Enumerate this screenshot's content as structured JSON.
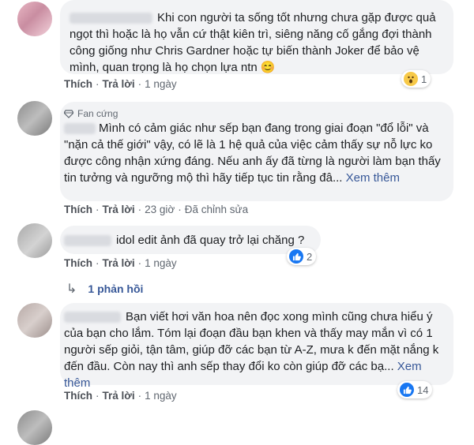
{
  "comments": [
    {
      "text": "Khi con người ta sống tốt nhưng chưa gặp được quả ngọt thì hoặc là họ vẫn cứ thật kiên trì, siêng năng cố gắng đợi thành công giống như Chris Gardner hoặc tự biến thành Joker để bảo vệ mình, quan trọng là họ chọn lựa ntn 😊",
      "like": "Thích",
      "reply": "Trả lời",
      "time": "1 ngày",
      "reaction_count": "1"
    },
    {
      "badge": "Fan cứng",
      "text": "Mình có cảm giác như sếp bạn đang trong giai đoạn \"đổ lỗi\" và \"nặn cả thế giới\" vậy, có lẽ là 1 hệ quả của việc cảm thấy sự nỗ lực ko được công nhận xứng đáng. Nếu anh ấy đã từng là người làm bạn thấy tin tưởng và ngưỡng mộ thì hãy tiếp tục tin rằng đâ...",
      "see_more": "Xem thêm",
      "like": "Thích",
      "reply": "Trả lời",
      "time": "23 giờ",
      "edited": "Đã chỉnh sửa"
    },
    {
      "text": "idol edit ảnh đã quay trở lại chăng ?",
      "like": "Thích",
      "reply": "Trả lời",
      "time": "1 ngày",
      "reaction_count": "2",
      "replies_label": "1 phản hồi"
    },
    {
      "text": "Bạn viết hơi văn hoa nên đọc xong mình cũng chưa hiểu ý của bạn cho lắm. Tóm lại đoạn đầu bạn khen và thấy may mắn vì có 1 người sếp giỏi, tận tâm, giúp đỡ các bạn từ A-Z, mưa k đến mặt nắng k đến đầu. Còn nay thì anh sếp thay đổi ko còn giúp đỡ các bạ...",
      "see_more": "Xem thêm",
      "like": "Thích",
      "reply": "Trả lời",
      "time": "1 ngày",
      "reaction_count": "14"
    }
  ],
  "colors": {
    "link": "#385898",
    "like_blue": "#1877f2",
    "bubble": "#f2f3f5"
  },
  "icons": [
    "diamond-icon",
    "like-reaction-icon",
    "wow-reaction-icon",
    "reply-arrow-icon"
  ]
}
